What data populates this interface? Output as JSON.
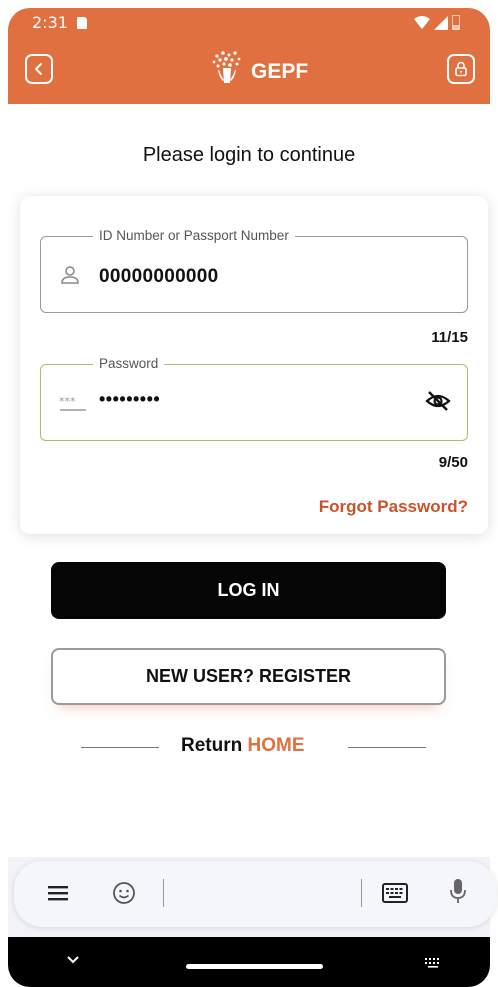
{
  "status_bar": {
    "time": "2:31"
  },
  "app_bar": {
    "title": "GEPF"
  },
  "heading": "Please login to continue",
  "form": {
    "id_field": {
      "label": "ID Number or Passport Number",
      "value": "00000000000",
      "counter": "11/15"
    },
    "password_field": {
      "label": "Password",
      "value": "•••••••••",
      "counter": "9/50"
    },
    "forgot_link": "Forgot Password?"
  },
  "buttons": {
    "login": "LOG IN",
    "register": "NEW USER? REGISTER"
  },
  "return_link": {
    "prefix": "Return ",
    "home": "HOME"
  },
  "colors": {
    "accent": "#e0703f",
    "link": "#c9532a",
    "focus_border": "#a9bd6b",
    "button_dark": "#050505"
  },
  "icons": [
    "back-icon",
    "logo-icon",
    "lock-icon",
    "user-icon",
    "password-icon",
    "eye-off-icon",
    "menu-icon",
    "emoji-icon",
    "keyboard-icon",
    "mic-icon",
    "chevron-down-icon"
  ]
}
